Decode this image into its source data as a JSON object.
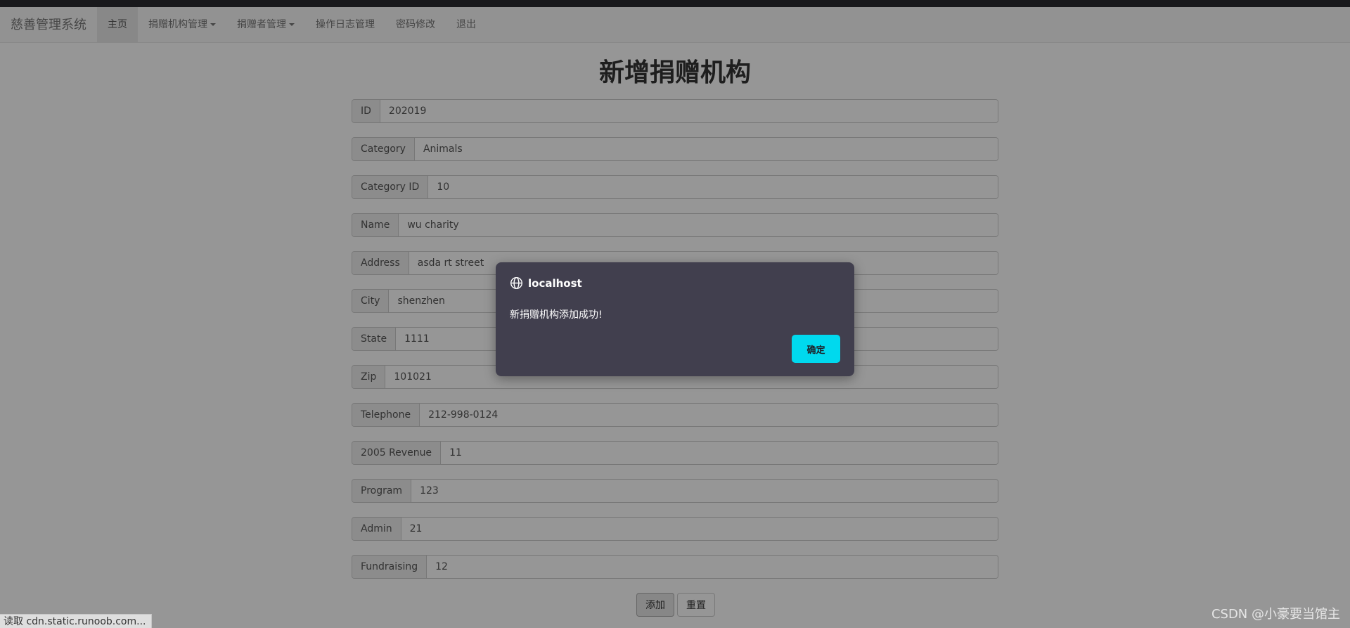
{
  "nav": {
    "brand": "慈善管理系统",
    "items": [
      {
        "label": "主页",
        "dropdown": false,
        "active": true
      },
      {
        "label": "捐赠机构管理",
        "dropdown": true,
        "active": false
      },
      {
        "label": "捐赠者管理",
        "dropdown": true,
        "active": false
      },
      {
        "label": "操作日志管理",
        "dropdown": false,
        "active": false
      },
      {
        "label": "密码修改",
        "dropdown": false,
        "active": false
      },
      {
        "label": "退出",
        "dropdown": false,
        "active": false
      }
    ]
  },
  "page_title": "新增捐赠机构",
  "form": {
    "fields": [
      {
        "label": "ID",
        "value": "202019"
      },
      {
        "label": "Category",
        "value": "Animals"
      },
      {
        "label": "Category ID",
        "value": "10"
      },
      {
        "label": "Name",
        "value": "wu charity"
      },
      {
        "label": "Address",
        "value": "asda rt street"
      },
      {
        "label": "City",
        "value": "shenzhen"
      },
      {
        "label": "State",
        "value": "1111"
      },
      {
        "label": "Zip",
        "value": "101021"
      },
      {
        "label": "Telephone",
        "value": "212-998-0124"
      },
      {
        "label": "2005 Revenue",
        "value": "11"
      },
      {
        "label": "Program",
        "value": "123"
      },
      {
        "label": "Admin",
        "value": "21"
      },
      {
        "label": "Fundraising",
        "value": "12"
      }
    ],
    "add_button": "添加",
    "reset_button": "重置"
  },
  "dialog": {
    "icon": "globe-icon",
    "title": "localhost",
    "message": "新捐赠机构添加成功!",
    "ok_button": "确定",
    "ok_color": "#00d9ee"
  },
  "status_bar": "读取 cdn.static.runoob.com...",
  "watermark": "CSDN @小豪要当馆主"
}
